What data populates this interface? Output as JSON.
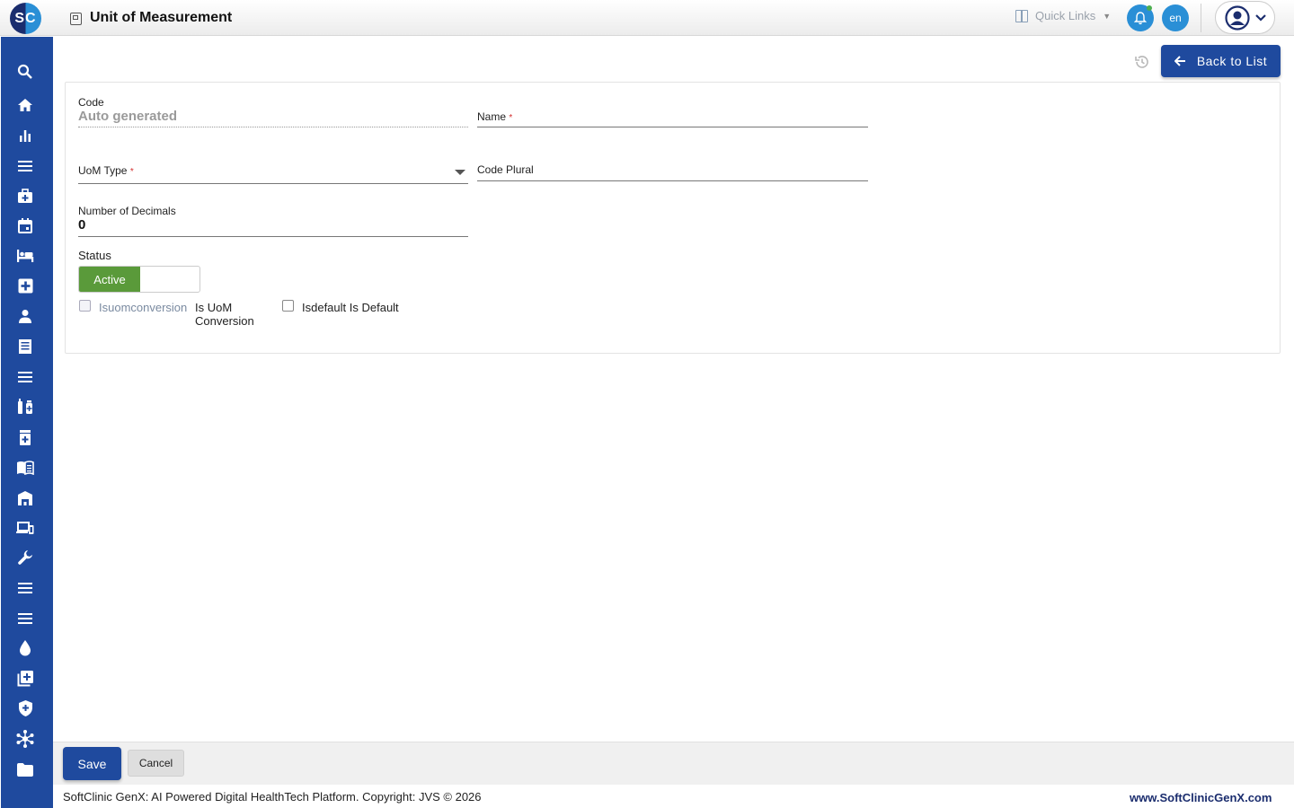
{
  "header": {
    "logo_text": "SC",
    "title": "Unit of Measurement",
    "quick_links_label": "Quick Links",
    "language": "en"
  },
  "sidebar": {
    "icons": [
      "search-icon",
      "home-icon",
      "bar-chart-icon",
      "menu-icon",
      "medical-bag-icon",
      "calendar-icon",
      "bed-icon",
      "medical-plus-icon",
      "person-icon",
      "receipt-icon",
      "menu-icon",
      "pharmacy-icon",
      "medicine-bottle-icon",
      "book-icon",
      "warehouse-icon",
      "devices-icon",
      "wrench-icon",
      "menu-icon",
      "menu-icon",
      "drop-icon",
      "library-add-icon",
      "shield-icon",
      "hub-icon",
      "folder-icon"
    ]
  },
  "toolbar": {
    "back_label": "Back to List"
  },
  "form": {
    "code_label": "Code",
    "code_value": "Auto generated",
    "name_label": "Name",
    "uom_type_label": "UoM Type",
    "code_plural_label": "Code Plural",
    "decimals_label": "Number of Decimals",
    "decimals_value": "0",
    "status_label": "Status",
    "status_active": "Active",
    "uom_conversion_key": "Isuomconversion",
    "uom_conversion_label": "Is UoM Conversion",
    "is_default_label": "Isdefault Is Default",
    "required_mark": "*"
  },
  "actions": {
    "save_label": "Save",
    "cancel_label": "Cancel"
  },
  "footer": {
    "copyright": "SoftClinic GenX: AI Powered Digital HealthTech Platform. Copyright: JVS © 2026",
    "website": "www.SoftClinicGenX.com"
  },
  "colors": {
    "primary": "#1f4a9e",
    "accent": "#2a8fd6",
    "active_green": "#5a9a3a",
    "required": "#d32f2f"
  }
}
